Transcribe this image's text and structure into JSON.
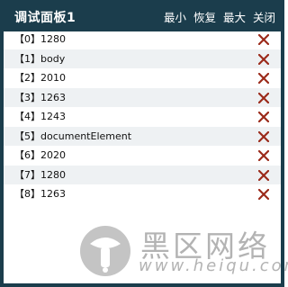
{
  "panel": {
    "title": "调试面板1",
    "actions": {
      "minimize": "最小",
      "restore": "恢复",
      "maximize": "最大",
      "close": "关闭"
    }
  },
  "rows": [
    {
      "text": "【0】1280"
    },
    {
      "text": "【1】body"
    },
    {
      "text": "【2】2010"
    },
    {
      "text": "【3】1263"
    },
    {
      "text": "【4】1243"
    },
    {
      "text": "【5】documentElement"
    },
    {
      "text": "【6】2020"
    },
    {
      "text": "【7】1280"
    },
    {
      "text": "【8】1263"
    }
  ],
  "watermark": {
    "brand": "黑区网络",
    "url": "www.heiqu.com"
  },
  "colors": {
    "titlebar": "#1b3d4c",
    "row_alt": "#eef1f3",
    "delete_icon": "#9b2a1a",
    "watermark": "#b3b3b3"
  }
}
